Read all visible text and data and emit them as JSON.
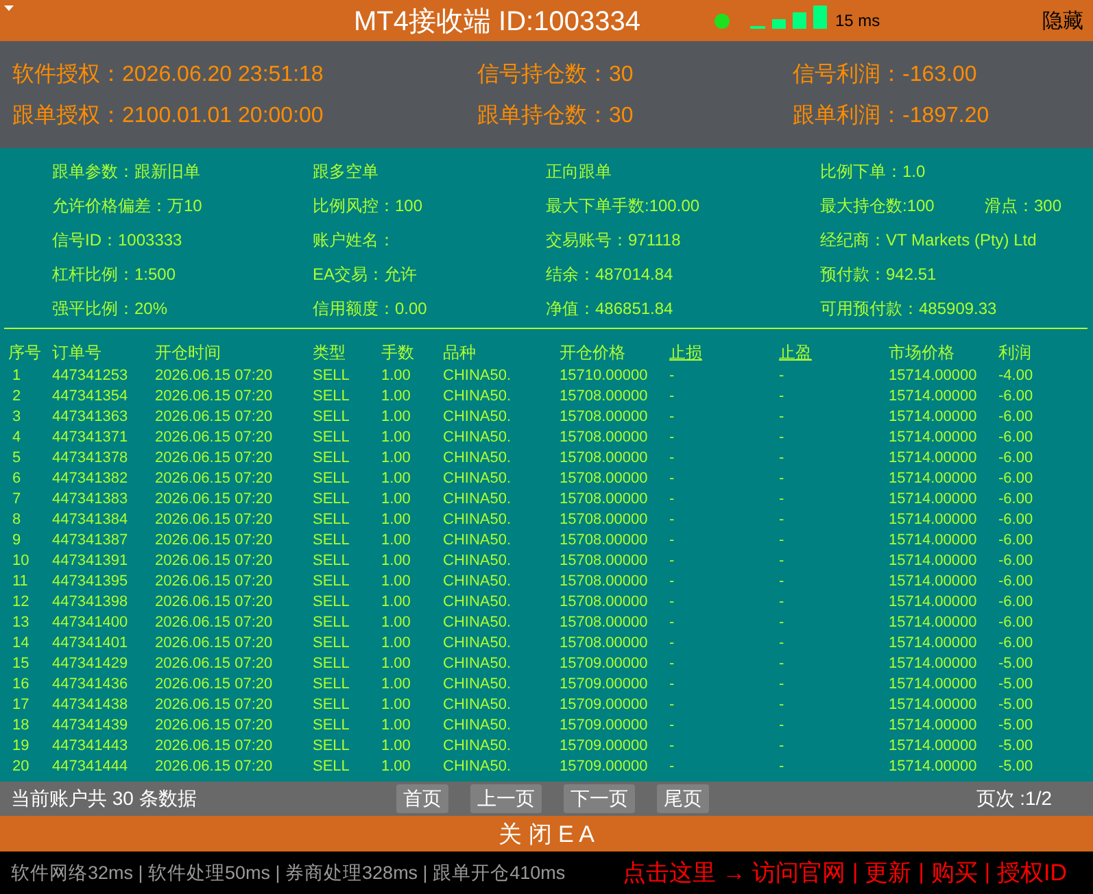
{
  "title_bar": {
    "title": "MT4接收端 ID:1003334",
    "connected": true,
    "latency": "15 ms",
    "hide_button": "隐藏"
  },
  "summary": [
    "软件授权：2026.06.20 23:51:18",
    "信号持仓数：30",
    "信号利润：-163.00",
    "跟单授权：2100.01.01 20:00:00",
    "跟单持仓数：30",
    "跟单利润：-1897.20"
  ],
  "parameters": [
    [
      "跟单参数：跟新旧单",
      "跟多空单",
      "正向跟单",
      "比例下单：1.0"
    ],
    [
      "允许价格偏差：万10",
      "比例风控：100",
      "最大下单手数:100.00",
      "最大持仓数:100",
      "滑点：300"
    ],
    [
      "信号ID：1003333",
      "账户姓名：",
      "交易账号：971118",
      "经纪商：VT Markets (Pty) Ltd"
    ],
    [
      "杠杆比例：1:500",
      "EA交易：允许",
      "结余：487014.84",
      "预付款：942.51"
    ],
    [
      "强平比例：20%",
      "信用额度：0.00",
      "净值：486851.84",
      "可用预付款：485909.33"
    ]
  ],
  "table": {
    "columns": [
      {
        "label": "序号",
        "underlined": false
      },
      {
        "label": "订单号",
        "underlined": false
      },
      {
        "label": "开仓时间",
        "underlined": false
      },
      {
        "label": "类型",
        "underlined": false
      },
      {
        "label": "手数",
        "underlined": false
      },
      {
        "label": "品种",
        "underlined": false
      },
      {
        "label": "开仓价格",
        "underlined": false
      },
      {
        "label": "止损",
        "underlined": true
      },
      {
        "label": "止盈",
        "underlined": true
      },
      {
        "label": "市场价格",
        "underlined": false
      },
      {
        "label": "利润",
        "underlined": false
      }
    ],
    "rows": [
      [
        "1",
        "447341253",
        "2026.06.15 07:20",
        "SELL",
        "1.00",
        "CHINA50.",
        "15710.00000",
        "-",
        "-",
        "15714.00000",
        "-4.00"
      ],
      [
        "2",
        "447341354",
        "2026.06.15 07:20",
        "SELL",
        "1.00",
        "CHINA50.",
        "15708.00000",
        "-",
        "-",
        "15714.00000",
        "-6.00"
      ],
      [
        "3",
        "447341363",
        "2026.06.15 07:20",
        "SELL",
        "1.00",
        "CHINA50.",
        "15708.00000",
        "-",
        "-",
        "15714.00000",
        "-6.00"
      ],
      [
        "4",
        "447341371",
        "2026.06.15 07:20",
        "SELL",
        "1.00",
        "CHINA50.",
        "15708.00000",
        "-",
        "-",
        "15714.00000",
        "-6.00"
      ],
      [
        "5",
        "447341378",
        "2026.06.15 07:20",
        "SELL",
        "1.00",
        "CHINA50.",
        "15708.00000",
        "-",
        "-",
        "15714.00000",
        "-6.00"
      ],
      [
        "6",
        "447341382",
        "2026.06.15 07:20",
        "SELL",
        "1.00",
        "CHINA50.",
        "15708.00000",
        "-",
        "-",
        "15714.00000",
        "-6.00"
      ],
      [
        "7",
        "447341383",
        "2026.06.15 07:20",
        "SELL",
        "1.00",
        "CHINA50.",
        "15708.00000",
        "-",
        "-",
        "15714.00000",
        "-6.00"
      ],
      [
        "8",
        "447341384",
        "2026.06.15 07:20",
        "SELL",
        "1.00",
        "CHINA50.",
        "15708.00000",
        "-",
        "-",
        "15714.00000",
        "-6.00"
      ],
      [
        "9",
        "447341387",
        "2026.06.15 07:20",
        "SELL",
        "1.00",
        "CHINA50.",
        "15708.00000",
        "-",
        "-",
        "15714.00000",
        "-6.00"
      ],
      [
        "10",
        "447341391",
        "2026.06.15 07:20",
        "SELL",
        "1.00",
        "CHINA50.",
        "15708.00000",
        "-",
        "-",
        "15714.00000",
        "-6.00"
      ],
      [
        "11",
        "447341395",
        "2026.06.15 07:20",
        "SELL",
        "1.00",
        "CHINA50.",
        "15708.00000",
        "-",
        "-",
        "15714.00000",
        "-6.00"
      ],
      [
        "12",
        "447341398",
        "2026.06.15 07:20",
        "SELL",
        "1.00",
        "CHINA50.",
        "15708.00000",
        "-",
        "-",
        "15714.00000",
        "-6.00"
      ],
      [
        "13",
        "447341400",
        "2026.06.15 07:20",
        "SELL",
        "1.00",
        "CHINA50.",
        "15708.00000",
        "-",
        "-",
        "15714.00000",
        "-6.00"
      ],
      [
        "14",
        "447341401",
        "2026.06.15 07:20",
        "SELL",
        "1.00",
        "CHINA50.",
        "15708.00000",
        "-",
        "-",
        "15714.00000",
        "-6.00"
      ],
      [
        "15",
        "447341429",
        "2026.06.15 07:20",
        "SELL",
        "1.00",
        "CHINA50.",
        "15709.00000",
        "-",
        "-",
        "15714.00000",
        "-5.00"
      ],
      [
        "16",
        "447341436",
        "2026.06.15 07:20",
        "SELL",
        "1.00",
        "CHINA50.",
        "15709.00000",
        "-",
        "-",
        "15714.00000",
        "-5.00"
      ],
      [
        "17",
        "447341438",
        "2026.06.15 07:20",
        "SELL",
        "1.00",
        "CHINA50.",
        "15709.00000",
        "-",
        "-",
        "15714.00000",
        "-5.00"
      ],
      [
        "18",
        "447341439",
        "2026.06.15 07:20",
        "SELL",
        "1.00",
        "CHINA50.",
        "15709.00000",
        "-",
        "-",
        "15714.00000",
        "-5.00"
      ],
      [
        "19",
        "447341443",
        "2026.06.15 07:20",
        "SELL",
        "1.00",
        "CHINA50.",
        "15709.00000",
        "-",
        "-",
        "15714.00000",
        "-5.00"
      ],
      [
        "20",
        "447341444",
        "2026.06.15 07:20",
        "SELL",
        "1.00",
        "CHINA50.",
        "15709.00000",
        "-",
        "-",
        "15714.00000",
        "-5.00"
      ]
    ]
  },
  "pager": {
    "summary": "当前账户共 30 条数据",
    "buttons": [
      "首页",
      "上一页",
      "下一页",
      "尾页"
    ],
    "page": "页次 :1/2"
  },
  "close_button": "关 闭 E A",
  "status_bar": {
    "timings": "软件网络32ms | 软件处理50ms | 券商处理328ms | 跟单开仓410ms",
    "items": [
      {
        "kind": "link",
        "text": "点击这里 → 访问官网"
      },
      {
        "kind": "separator",
        "text": "|"
      },
      {
        "kind": "link",
        "text": "更新"
      },
      {
        "kind": "separator",
        "text": "|"
      },
      {
        "kind": "link",
        "text": "购买"
      },
      {
        "kind": "separator",
        "text": "|"
      },
      {
        "kind": "link",
        "text": "授权ID"
      }
    ]
  }
}
